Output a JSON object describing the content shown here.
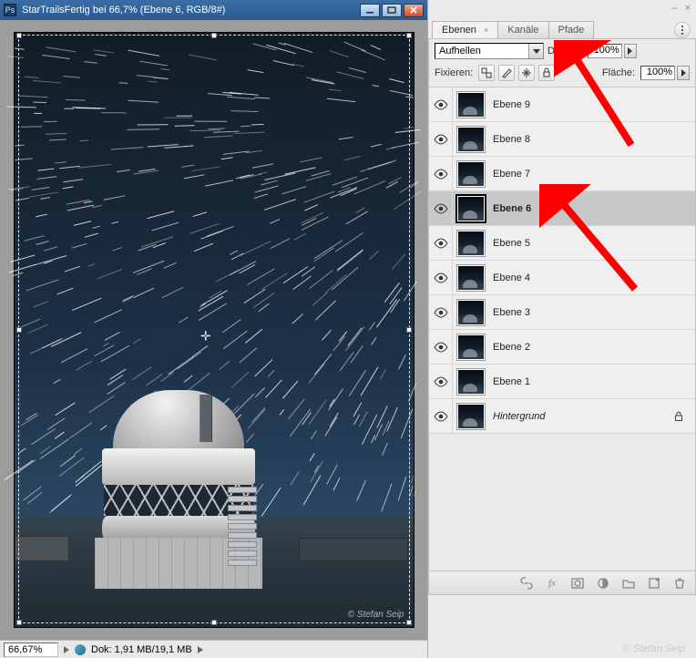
{
  "doc": {
    "title_app": "Ps",
    "title_text": "StarTrailsFertig bei 66,7% (Ebene 6, RGB/8#)",
    "watermark": "© Stefan Seip",
    "status_zoom": "66,67%",
    "status_doc": "Dok: 1,91 MB/19,1 MB"
  },
  "panel": {
    "tabs": {
      "layers": "Ebenen",
      "channels": "Kanäle",
      "paths": "Pfade"
    },
    "blend_mode": "Aufhellen",
    "opacity_label": "Deckkr.:",
    "opacity_value": "100%",
    "lock_label": "Fixieren:",
    "fill_label": "Fläche:",
    "fill_value": "100%"
  },
  "layers": [
    {
      "name": "Ebene 9",
      "selected": false
    },
    {
      "name": "Ebene 8",
      "selected": false
    },
    {
      "name": "Ebene 7",
      "selected": false
    },
    {
      "name": "Ebene 6",
      "selected": true
    },
    {
      "name": "Ebene 5",
      "selected": false
    },
    {
      "name": "Ebene 4",
      "selected": false
    },
    {
      "name": "Ebene 3",
      "selected": false
    },
    {
      "name": "Ebene 2",
      "selected": false
    },
    {
      "name": "Ebene 1",
      "selected": false
    },
    {
      "name": "Hintergrund",
      "selected": false,
      "background": true,
      "locked": true
    }
  ],
  "footer": {
    "fx": "fx"
  },
  "credit": "© Stefan Seip",
  "colors": {
    "arrow": "#ff0000"
  }
}
